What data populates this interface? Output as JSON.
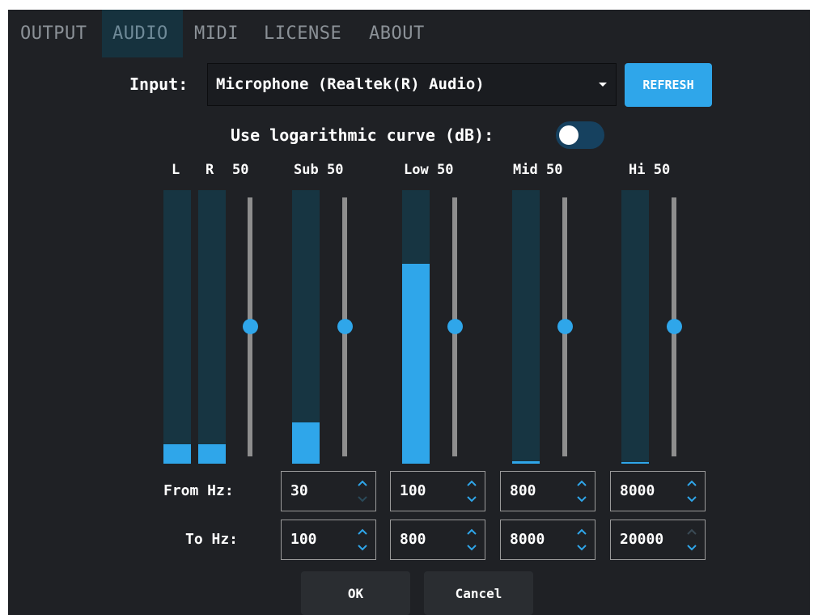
{
  "tabs": [
    {
      "label": "OUTPUT",
      "active": false
    },
    {
      "label": "AUDIO",
      "active": true
    },
    {
      "label": "MIDI",
      "active": false
    },
    {
      "label": "LICENSE",
      "active": false
    },
    {
      "label": "ABOUT",
      "active": false
    }
  ],
  "input": {
    "label": "Input:",
    "selected": "Microphone (Realtek(R) Audio)",
    "refresh_label": "REFRESH"
  },
  "log_curve": {
    "label": "Use logarithmic curve (dB):",
    "enabled": false
  },
  "channels": {
    "l_label": "L",
    "r_label": "R",
    "gain": "50",
    "l_level": 0.07,
    "r_level": 0.07,
    "gain_level": 0.5
  },
  "bands": [
    {
      "name": "Sub",
      "gain": "50",
      "level": 0.15,
      "gain_level": 0.5,
      "from_hz": "30",
      "to_hz": "100"
    },
    {
      "name": "Low",
      "gain": "50",
      "level": 0.73,
      "gain_level": 0.5,
      "from_hz": "100",
      "to_hz": "800"
    },
    {
      "name": "Mid",
      "gain": "50",
      "level": 0.01,
      "gain_level": 0.5,
      "from_hz": "800",
      "to_hz": "8000"
    },
    {
      "name": "Hi",
      "gain": "50",
      "level": 0.006,
      "gain_level": 0.5,
      "from_hz": "8000",
      "to_hz": "20000"
    }
  ],
  "from_hz_label": "From Hz:",
  "to_hz_label": "To Hz:",
  "buttons": {
    "ok": "OK",
    "cancel": "Cancel"
  },
  "colors": {
    "accent": "#2fa6ea",
    "background": "#1f2125",
    "meter_track": "#173542",
    "active_tab": "#16323e"
  }
}
